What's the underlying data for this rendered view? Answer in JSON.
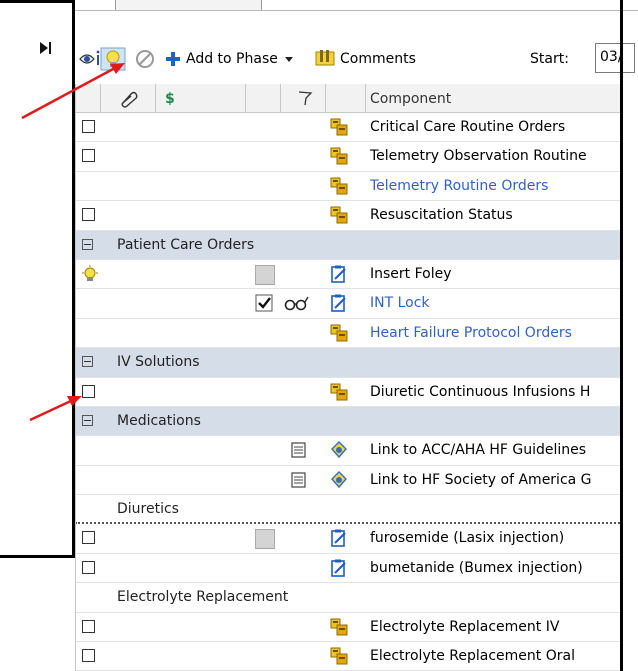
{
  "toolbar": {
    "add_to_phase": "Add to Phase",
    "comments": "Comments",
    "start_label": "Start:",
    "start_value": "03/"
  },
  "columns": {
    "dollar": "$",
    "component": "Component"
  },
  "rows": [
    {
      "type": "order",
      "checkbox": true,
      "icon": "order-set-icon",
      "label": "Critical Care Routine Orders",
      "link": false
    },
    {
      "type": "order",
      "checkbox": true,
      "icon": "order-set-icon",
      "label": "Telemetry Observation Routine",
      "link": false
    },
    {
      "type": "order",
      "checkbox": false,
      "icon": "order-set-icon",
      "label": "Telemetry Routine Orders",
      "link": true
    },
    {
      "type": "order",
      "checkbox": true,
      "icon": "order-set-icon",
      "label": "Resuscitation Status",
      "link": false
    },
    {
      "type": "category",
      "label": "Patient Care Orders"
    },
    {
      "type": "order",
      "checkbox": false,
      "icon": "clipboard-icon",
      "label": "Insert Foley",
      "link": false
    },
    {
      "type": "order",
      "checkbox": false,
      "icon": "clipboard-icon",
      "label": "INT Lock",
      "link": true
    },
    {
      "type": "order",
      "checkbox": false,
      "icon": "order-set-icon",
      "label": "Heart Failure Protocol Orders",
      "link": true
    },
    {
      "type": "category",
      "label": "IV Solutions"
    },
    {
      "type": "order",
      "checkbox": true,
      "icon": "order-set-icon",
      "label": "Diuretic Continuous Infusions H",
      "link": false
    },
    {
      "type": "category",
      "label": "Medications"
    },
    {
      "type": "order",
      "checkbox": false,
      "icon": "link-icon",
      "label": "Link to ACC/AHA HF Guidelines",
      "link": false
    },
    {
      "type": "order",
      "checkbox": false,
      "icon": "link-icon",
      "label": "Link to HF Society of America G",
      "link": false
    },
    {
      "type": "subcategory",
      "label": "Diuretics"
    },
    {
      "type": "order",
      "checkbox": true,
      "icon": "clipboard-icon",
      "label": "furosemide (Lasix injection)",
      "link": false
    },
    {
      "type": "order",
      "checkbox": true,
      "icon": "clipboard-icon",
      "label": "bumetanide (Bumex injection)",
      "link": false
    },
    {
      "type": "subcategory",
      "label": "Electrolyte Replacement"
    },
    {
      "type": "order",
      "checkbox": true,
      "icon": "order-set-icon",
      "label": "Electrolyte Replacement IV",
      "link": false
    },
    {
      "type": "order",
      "checkbox": true,
      "icon": "order-set-icon",
      "label": "Electrolyte Replacement Oral",
      "link": false
    }
  ],
  "colors": {
    "category_bg": "#d5dde9",
    "link": "#2f62c7",
    "arrow": "#e11b1b",
    "order_set_icon": "#e8b400"
  }
}
